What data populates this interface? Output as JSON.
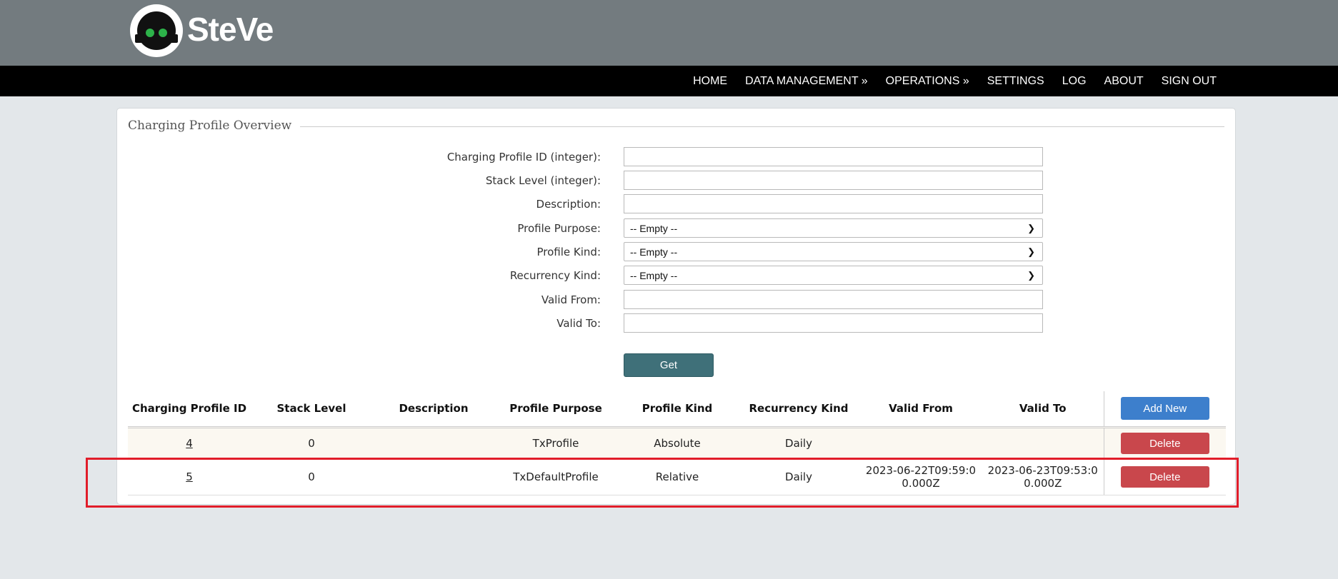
{
  "app": {
    "brand": "SteVe"
  },
  "nav": [
    "HOME",
    "DATA MANAGEMENT »",
    "OPERATIONS »",
    "SETTINGS",
    "LOG",
    "ABOUT",
    "SIGN OUT"
  ],
  "panel": {
    "title": "Charging Profile Overview"
  },
  "form": {
    "id_label": "Charging Profile ID (integer):",
    "stack_label": "Stack Level (integer):",
    "desc_label": "Description:",
    "purpose_label": "Profile Purpose:",
    "purpose_value": "-- Empty --",
    "kind_label": "Profile Kind:",
    "kind_value": "-- Empty --",
    "recur_label": "Recurrency Kind:",
    "recur_value": "-- Empty --",
    "from_label": "Valid From:",
    "to_label": "Valid To:",
    "get_label": "Get"
  },
  "table": {
    "headers": [
      "Charging Profile ID",
      "Stack Level",
      "Description",
      "Profile Purpose",
      "Profile Kind",
      "Recurrency Kind",
      "Valid From",
      "Valid To"
    ],
    "add_label": "Add New",
    "delete_label": "Delete",
    "rows": [
      {
        "id": "4",
        "stack": "0",
        "description": "",
        "purpose": "TxProfile",
        "kind": "Absolute",
        "recurrency": "Daily",
        "from": "",
        "to": ""
      },
      {
        "id": "5",
        "stack": "0",
        "description": "",
        "purpose": "TxDefaultProfile",
        "kind": "Relative",
        "recurrency": "Daily",
        "from": "2023-06-22T09:59:00.000Z",
        "to": "2023-06-23T09:53:00.000Z"
      }
    ]
  },
  "colors": {
    "header": "#737b7f",
    "accent": "#3f7079",
    "add": "#3d7fcc",
    "delete": "#c9474c",
    "highlight": "#e11d2a"
  }
}
